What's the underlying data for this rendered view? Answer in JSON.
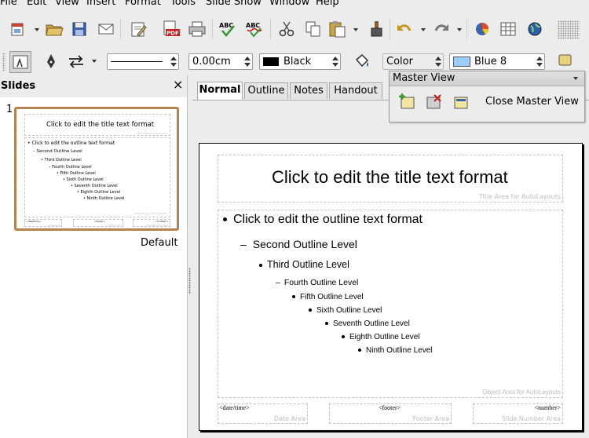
{
  "menu": [
    "File",
    "Edit",
    "View",
    "Insert",
    "Format",
    "Tools",
    "Slide Show",
    "Window",
    "Help"
  ],
  "toolbar2": {
    "line_width": "0.00cm",
    "line_color": "Black",
    "area_style": "Color",
    "area_color": "Blue 8"
  },
  "colors": {
    "line_color_swatch": "#000000",
    "area_color_swatch": "#99ccff",
    "thumb_border": "#b5834f"
  },
  "slides_pane": {
    "title": "Slides",
    "close": "×",
    "slide_number": "1",
    "slide_name": "Default"
  },
  "tabs": [
    "Normal",
    "Outline",
    "Notes",
    "Handout"
  ],
  "master_view": {
    "title": "Master View",
    "close_button": "Close Master View"
  },
  "slide": {
    "title_text": "Click to edit the title text format",
    "title_area_label": "Title Area for AutoLayouts",
    "outline": [
      "Click to edit the outline text format",
      "Second Outline Level",
      "Third Outline Level",
      "Fourth Outline Level",
      "Fifth Outline Level",
      "Sixth Outline Level",
      "Seventh Outline Level",
      "Eighth Outline Level",
      "Ninth Outline Level"
    ],
    "object_area_label": "Object Area for AutoLayouts",
    "date_field": "<date/time>",
    "date_area_label": "Date Area",
    "footer_field": "<footer>",
    "footer_area_label": "Footer Area",
    "number_field": "<number>",
    "number_area_label": "Slide Number Area"
  }
}
